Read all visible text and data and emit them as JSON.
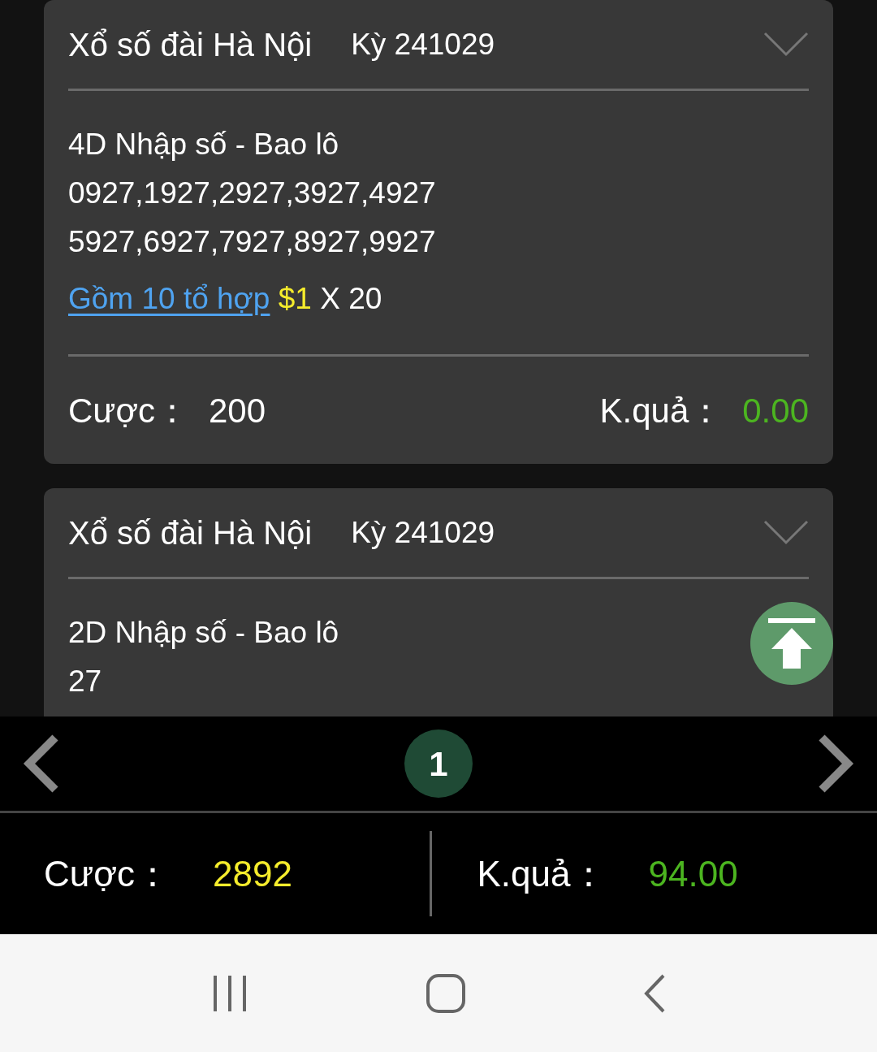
{
  "cards": [
    {
      "title": "Xổ số đài Hà Nội",
      "period": "Kỳ 241029",
      "bet_type": "4D Nhập số - Bao lô",
      "numbers": [
        "0927,1927,2927,3927,4927",
        "5927,6927,7927,8927,9927"
      ],
      "combo_link": "Gồm 10 tổ hợp",
      "unit": "$1",
      "multiplier": "X 20",
      "bet_label": "Cược：",
      "bet": "200",
      "result_label": "K.quả：",
      "result": "0.00"
    },
    {
      "title": "Xổ số đài Hà Nội",
      "period": "Kỳ 241029",
      "bet_type": "2D Nhập số - Bao lô",
      "numbers": [
        "27"
      ]
    }
  ],
  "pager": {
    "pages": [
      {
        "label": "1",
        "selected": true
      }
    ]
  },
  "totals": {
    "bet_label": "Cược：",
    "bet": "2892",
    "result_label": "K.quả：",
    "result": "94.00"
  }
}
